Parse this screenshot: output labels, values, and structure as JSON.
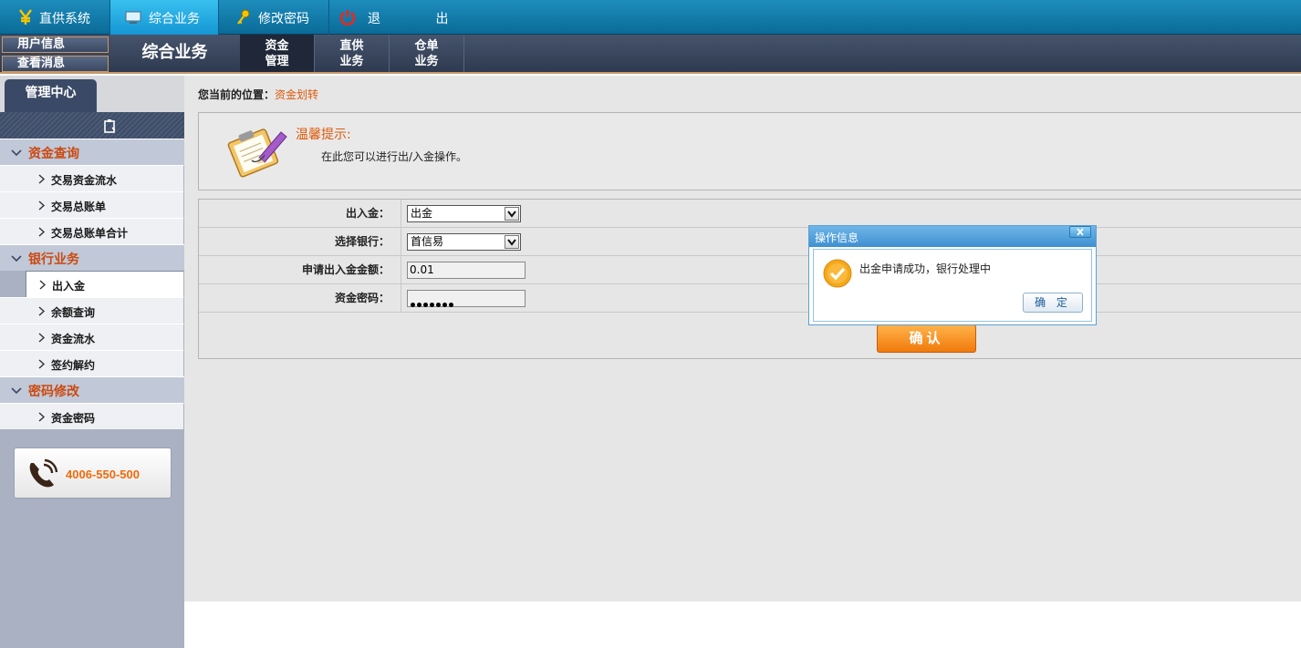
{
  "top_nav": [
    {
      "label": "直供系统",
      "icon": "yen-icon"
    },
    {
      "label": "综合业务",
      "icon": "monitor-icon",
      "active": true
    },
    {
      "label": "修改密码",
      "icon": "key-icon"
    },
    {
      "label": "退 出",
      "icon": "power-icon"
    }
  ],
  "user_menu": {
    "user_info": "用户信息",
    "view_messages": "查看消息"
  },
  "section_title": "综合业务",
  "sub_tabs": [
    {
      "line1": "资金",
      "line2": "管理",
      "active": true
    },
    {
      "line1": "直供",
      "line2": "业务"
    },
    {
      "line1": "仓单",
      "line2": "业务"
    }
  ],
  "sidebar": {
    "tab": "管理中心",
    "groups": [
      {
        "label": "资金查询",
        "items": [
          "交易资金流水",
          "交易总账单",
          "交易总账单合计"
        ]
      },
      {
        "label": "银行业务",
        "items": [
          "出入金",
          "余额查询",
          "资金流水",
          "签约解约"
        ]
      },
      {
        "label": "密码修改",
        "items": [
          "资金密码"
        ]
      }
    ],
    "selected_item": "出入金",
    "phone": "4006-550-500"
  },
  "breadcrumb": {
    "prefix": "您当前的位置：",
    "current": "资金划转"
  },
  "tip": {
    "title": "温馨提示:",
    "text": "在此您可以进行出/入金操作。"
  },
  "form": {
    "direction": {
      "label": "出入金：",
      "value": "出金"
    },
    "bank": {
      "label": "选择银行：",
      "value": "首信易"
    },
    "amount": {
      "label": "申请出入金金额：",
      "value": "0.01"
    },
    "password": {
      "label": "资金密码：",
      "masked_length": 7
    },
    "confirm_label": "确认"
  },
  "dialog": {
    "title": "操作信息",
    "message": "出金申请成功，银行处理中",
    "ok_label": "确 定"
  },
  "colors": {
    "accent_orange": "#f07a0c",
    "nav_blue": "#1496d3",
    "sidebar_group_text": "#cb4a10"
  }
}
